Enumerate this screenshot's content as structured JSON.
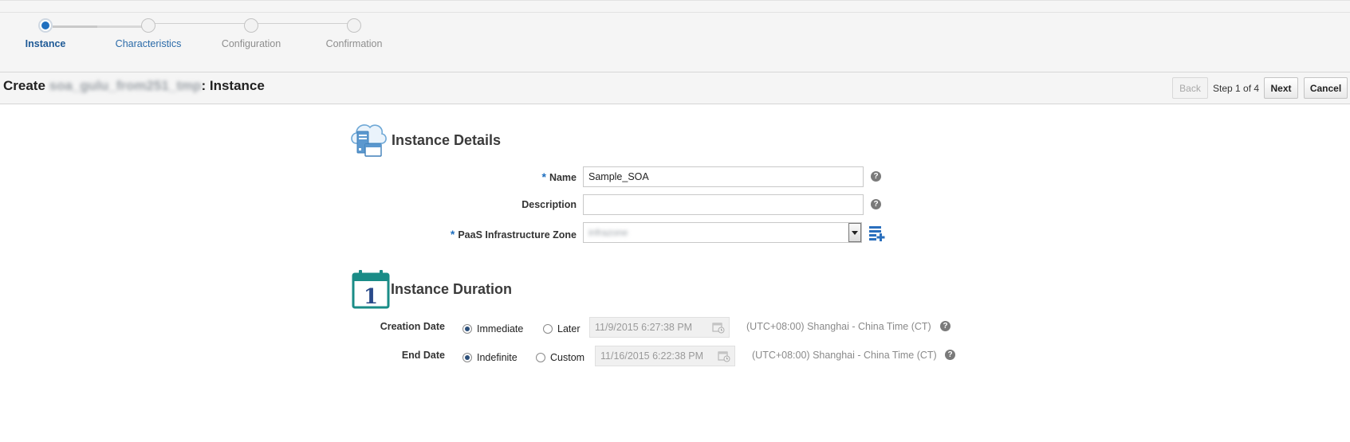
{
  "train": {
    "steps": [
      {
        "label": "Instance",
        "state": "active"
      },
      {
        "label": "Characteristics",
        "state": "link"
      },
      {
        "label": "Configuration",
        "state": "disabled"
      },
      {
        "label": "Confirmation",
        "state": "disabled"
      }
    ]
  },
  "header": {
    "title_prefix": "Create ",
    "title_blurred": "soa_gulu_from251_tmp",
    "title_suffix": ": Instance",
    "back_label": "Back",
    "step_text": "Step 1 of 4",
    "next_label": "Next",
    "cancel_label": "Cancel"
  },
  "instance_details": {
    "title": "Instance Details",
    "icon": "cloud-server-icon",
    "name_label": "Name",
    "name_value": "Sample_SOA",
    "description_label": "Description",
    "description_value": "",
    "zone_label": "PaaS Infrastructure Zone",
    "zone_value": "infrazone",
    "add_zone_icon": "add-list-icon"
  },
  "instance_duration": {
    "title": "Instance Duration",
    "icon": "calendar-icon",
    "calendar_number": "1",
    "creation_label": "Creation Date",
    "creation_immediate": "Immediate",
    "creation_later": "Later",
    "creation_date_value": "11/9/2015 6:27:38 PM",
    "creation_tz": "(UTC+08:00) Shanghai - China Time (CT)",
    "end_label": "End Date",
    "end_indefinite": "Indefinite",
    "end_custom": "Custom",
    "end_date_value": "11/16/2015 6:22:38 PM",
    "end_tz": "(UTC+08:00) Shanghai - China Time (CT)",
    "creation_mode": "Immediate",
    "end_mode": "Indefinite"
  },
  "colors": {
    "accent": "#1f6fbf",
    "header_bg": "#f5f5f5",
    "teal_icon": "#1a8c87"
  }
}
